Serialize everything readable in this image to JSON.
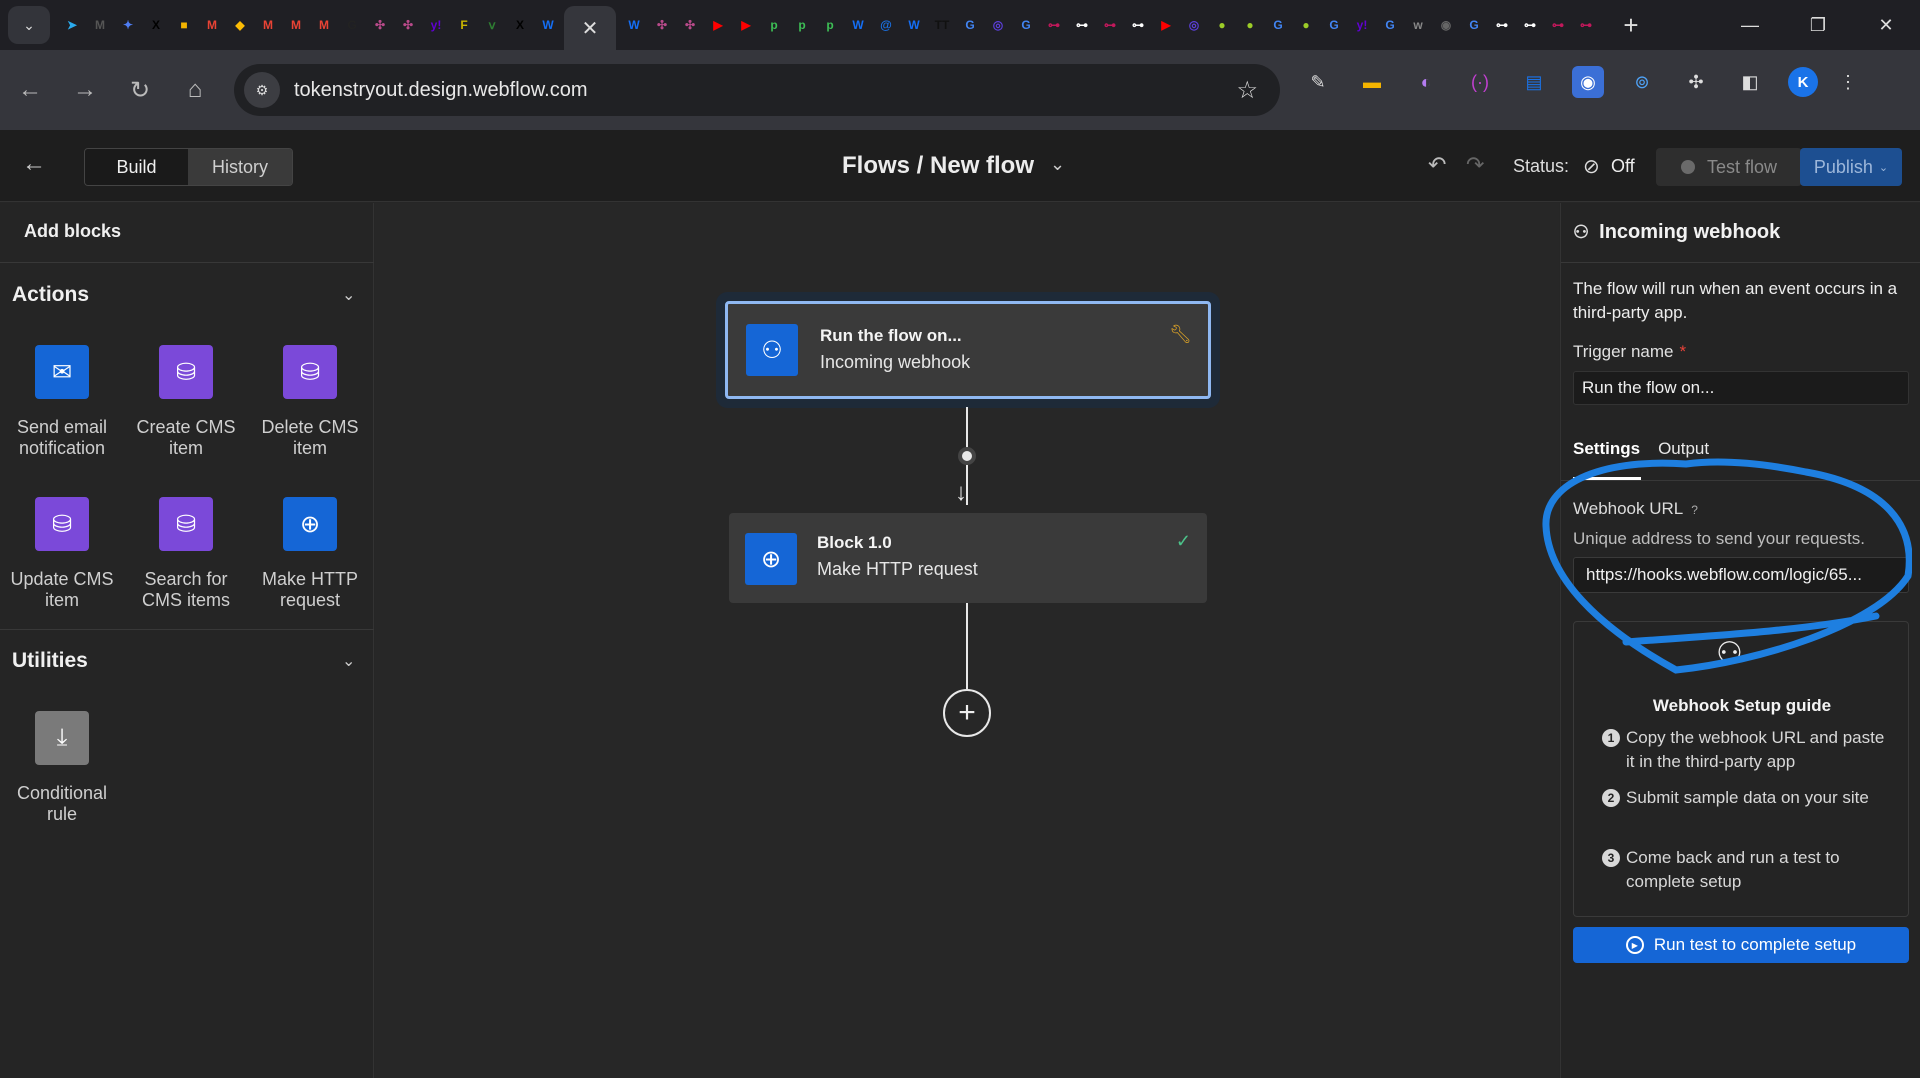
{
  "browser": {
    "tab_favicons": [
      {
        "name": "telegram-favicon",
        "glyph": "➤",
        "color": "#2AABEE"
      },
      {
        "name": "medium-favicon",
        "glyph": "M",
        "color": "#555555"
      },
      {
        "name": "gemini-favicon",
        "glyph": "✦",
        "color": "#4F7DF3"
      },
      {
        "name": "x-favicon",
        "glyph": "X",
        "color": "#000000"
      },
      {
        "name": "yellow-app-favicon",
        "glyph": "■",
        "color": "#F4B400"
      },
      {
        "name": "gmail-favicon",
        "glyph": "M",
        "color": "#EA4335"
      },
      {
        "name": "drive-favicon",
        "glyph": "◆",
        "color": "#FBBC05"
      },
      {
        "name": "gmail-favicon",
        "glyph": "M",
        "color": "#EA4335"
      },
      {
        "name": "gmail-favicon",
        "glyph": "M",
        "color": "#EA4335"
      },
      {
        "name": "gmail-favicon",
        "glyph": "M",
        "color": "#EA4335"
      },
      {
        "name": "g-favicon",
        "glyph": "G",
        "color": "#222222"
      },
      {
        "name": "puzzle-favicon",
        "glyph": "✣",
        "color": "#B84A8A"
      },
      {
        "name": "puzzle-favicon",
        "glyph": "✣",
        "color": "#B84A8A"
      },
      {
        "name": "yahoo-favicon",
        "glyph": "y!",
        "color": "#6001D2"
      },
      {
        "name": "f-favicon",
        "glyph": "F",
        "color": "#C8B400"
      },
      {
        "name": "vine-favicon",
        "glyph": "ⅴ",
        "color": "#2E7D32"
      },
      {
        "name": "x-favicon",
        "glyph": "X",
        "color": "#000000"
      },
      {
        "name": "webflow-favicon",
        "glyph": "W",
        "color": "#146EF5"
      }
    ],
    "tab_favicons_right": [
      {
        "name": "webflow-favicon",
        "glyph": "W",
        "color": "#146EF5"
      },
      {
        "name": "puzzle-favicon",
        "glyph": "✣",
        "color": "#B84A8A"
      },
      {
        "name": "puzzle-favicon",
        "glyph": "✣",
        "color": "#B84A8A"
      },
      {
        "name": "youtube-favicon",
        "glyph": "▶",
        "color": "#FF0000"
      },
      {
        "name": "youtube-favicon",
        "glyph": "▶",
        "color": "#FF0000"
      },
      {
        "name": "p-favicon",
        "glyph": "p",
        "color": "#3DBE55"
      },
      {
        "name": "p-favicon",
        "glyph": "p",
        "color": "#3DBE55"
      },
      {
        "name": "p-favicon",
        "glyph": "p",
        "color": "#3DBE55"
      },
      {
        "name": "webflow-favicon",
        "glyph": "W",
        "color": "#146EF5"
      },
      {
        "name": "at-favicon",
        "glyph": "@",
        "color": "#1A73E8"
      },
      {
        "name": "webflow-favicon",
        "glyph": "W",
        "color": "#146EF5"
      },
      {
        "name": "tt-favicon",
        "glyph": "TT",
        "color": "#111111"
      },
      {
        "name": "google-favicon",
        "glyph": "G",
        "color": "#4285F4"
      },
      {
        "name": "spiral-favicon",
        "glyph": "◎",
        "color": "#5B3FD9"
      },
      {
        "name": "google-favicon",
        "glyph": "G",
        "color": "#4285F4"
      },
      {
        "name": "link-favicon",
        "glyph": "⊶",
        "color": "#C2185B"
      },
      {
        "name": "link-favicon",
        "glyph": "⊶",
        "color": "#FFFFFF"
      },
      {
        "name": "link-favicon",
        "glyph": "⊶",
        "color": "#C2185B"
      },
      {
        "name": "link-favicon",
        "glyph": "⊶",
        "color": "#FFFFFF"
      },
      {
        "name": "youtube-favicon",
        "glyph": "▶",
        "color": "#FF0000"
      },
      {
        "name": "spiral-favicon",
        "glyph": "◎",
        "color": "#5B3FD9"
      },
      {
        "name": "lime-favicon",
        "glyph": "●",
        "color": "#9CCC28"
      },
      {
        "name": "lime-favicon",
        "glyph": "●",
        "color": "#9CCC28"
      },
      {
        "name": "google-favicon",
        "glyph": "G",
        "color": "#4285F4"
      },
      {
        "name": "lime-favicon",
        "glyph": "●",
        "color": "#9CCC28"
      },
      {
        "name": "google-favicon",
        "glyph": "G",
        "color": "#4285F4"
      },
      {
        "name": "yahoo-favicon",
        "glyph": "y!",
        "color": "#6001D2"
      },
      {
        "name": "google-favicon",
        "glyph": "G",
        "color": "#4285F4"
      },
      {
        "name": "w-favicon",
        "glyph": "w",
        "color": "#888888"
      },
      {
        "name": "broadcast-favicon",
        "glyph": "◉",
        "color": "#666666"
      },
      {
        "name": "google-favicon",
        "glyph": "G",
        "color": "#4285F4"
      },
      {
        "name": "link-favicon",
        "glyph": "⊶",
        "color": "#FFFFFF"
      },
      {
        "name": "link-favicon",
        "glyph": "⊶",
        "color": "#FFFFFF"
      },
      {
        "name": "link-favicon",
        "glyph": "⊶",
        "color": "#C2185B"
      },
      {
        "name": "link-favicon",
        "glyph": "⊶",
        "color": "#C2185B"
      }
    ],
    "url": "tokenstryout.design.webflow.com",
    "profile_initial": "K"
  },
  "header": {
    "build_tab": "Build",
    "history_tab": "History",
    "breadcrumb": "Flows / New flow",
    "status_label": "Status:",
    "status_value": "Off",
    "test_flow": "Test flow",
    "publish": "Publish"
  },
  "left_panel": {
    "title": "Add blocks",
    "actions_title": "Actions",
    "actions": [
      {
        "label": "Send email notification",
        "icon": "mail-icon",
        "glyph": "✉",
        "color": "#1566D6"
      },
      {
        "label": "Create CMS item",
        "icon": "database-plus-icon",
        "glyph": "⛁",
        "color": "#7B49D9"
      },
      {
        "label": "Delete CMS item",
        "icon": "database-x-icon",
        "glyph": "⛁",
        "color": "#7B49D9"
      },
      {
        "label": "Update CMS item",
        "icon": "database-refresh-icon",
        "glyph": "⛁",
        "color": "#7B49D9"
      },
      {
        "label": "Search for CMS items",
        "icon": "database-search-icon",
        "glyph": "⛁",
        "color": "#7B49D9"
      },
      {
        "label": "Make HTTP request",
        "icon": "globe-icon",
        "glyph": "⊕",
        "color": "#1566D6"
      }
    ],
    "utilities_title": "Utilities",
    "utilities": [
      {
        "label": "Conditional rule",
        "icon": "branch-icon",
        "glyph": "⤓",
        "color": "#7A7A7A"
      }
    ]
  },
  "canvas": {
    "trigger": {
      "title": "Run the flow on...",
      "subtitle": "Incoming webhook",
      "icon": "webhook-icon"
    },
    "block": {
      "title": "Block 1.0",
      "subtitle": "Make HTTP request",
      "icon": "globe-icon"
    }
  },
  "right_panel": {
    "title": "Incoming webhook",
    "description": "The flow will run when an event occurs in a third-party app.",
    "trigger_name_label": "Trigger name",
    "required_mark": "*",
    "trigger_name_value": "Run the flow on...",
    "tabs": [
      "Settings",
      "Output"
    ],
    "webhook_url_label": "Webhook URL",
    "help_mark": "?",
    "webhook_url_hint": "Unique address to send your requests.",
    "webhook_url_value": "https://hooks.webflow.com/logic/65...",
    "guide_title": "Webhook Setup guide",
    "steps": [
      {
        "num": "1",
        "text": "Copy the webhook URL and paste it in the third-party app"
      },
      {
        "num": "2",
        "text": "Submit sample data on your site"
      },
      {
        "num": "3",
        "text": "Come back and run a test to complete setup"
      }
    ],
    "run_test_button": "Run test to complete setup"
  },
  "annotation": {
    "color": "#1E7FE0"
  }
}
